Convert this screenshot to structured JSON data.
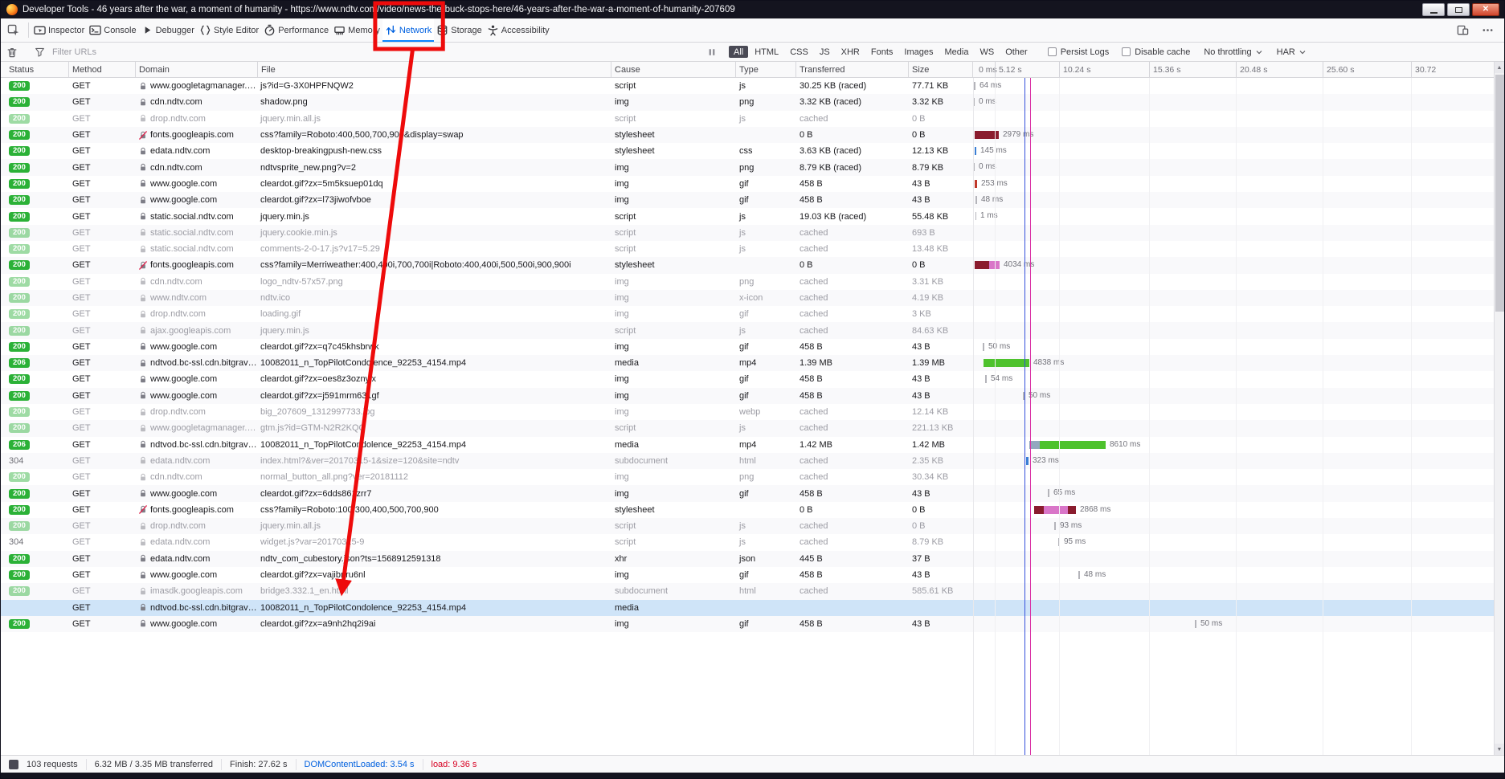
{
  "window": {
    "title": "Developer Tools - 46 years after the war, a moment of humanity - https://www.ndtv.com/video/news-the-buck-stops-here/46-years-after-the-war-a-moment-of-humanity-207609"
  },
  "tabs": [
    {
      "id": "inspector",
      "label": "Inspector",
      "icon": "inspector-icon"
    },
    {
      "id": "console",
      "label": "Console",
      "icon": "console-icon"
    },
    {
      "id": "debugger",
      "label": "Debugger",
      "icon": "debugger-icon"
    },
    {
      "id": "style-editor",
      "label": "Style Editor",
      "icon": "style-editor-icon"
    },
    {
      "id": "performance",
      "label": "Performance",
      "icon": "performance-icon"
    },
    {
      "id": "memory",
      "label": "Memory",
      "icon": "memory-icon"
    },
    {
      "id": "network",
      "label": "Network",
      "icon": "network-icon",
      "active": true
    },
    {
      "id": "storage",
      "label": "Storage",
      "icon": "storage-icon"
    },
    {
      "id": "accessibility",
      "label": "Accessibility",
      "icon": "accessibility-icon"
    }
  ],
  "toolbar_right": [
    {
      "id": "responsive-mode",
      "icon": "responsive-design-mode-icon"
    },
    {
      "id": "meatball-menu",
      "icon": "settings-menu-icon"
    }
  ],
  "filterbar": {
    "placeholder": "Filter URLs",
    "filters": [
      "All",
      "HTML",
      "CSS",
      "JS",
      "XHR",
      "Fonts",
      "Images",
      "Media",
      "WS",
      "Other"
    ],
    "active_filter": "All",
    "persist_logs": "Persist Logs",
    "disable_cache": "Disable cache",
    "throttling": "No throttling",
    "har": "HAR"
  },
  "table": {
    "columns": [
      "Status",
      "Method",
      "Domain",
      "File",
      "Cause",
      "Type",
      "Transferred",
      "Size"
    ],
    "timeline_ticks": [
      "0 ms",
      "5.12 s",
      "10.24 s",
      "15.36 s",
      "20.48 s",
      "25.60 s",
      "30.72"
    ],
    "rows": [
      {
        "status": "200",
        "method": "GET",
        "domain": "www.googletagmanager.com",
        "file": "js?id=G-3X0HPFNQW2",
        "cause": "script",
        "type": "js",
        "transferred": "30.25 KB (raced)",
        "size": "77.71 KB",
        "waterfall": {
          "o": 1,
          "segs": [
            [
              "gray",
              2
            ]
          ],
          "label": "64 ms"
        }
      },
      {
        "status": "200",
        "method": "GET",
        "domain": "cdn.ndtv.com",
        "file": "shadow.png",
        "cause": "img",
        "type": "png",
        "transferred": "3.32 KB (raced)",
        "size": "3.32 KB",
        "waterfall": {
          "o": 1,
          "segs": [
            [
              "gray",
              1
            ]
          ],
          "label": "0 ms"
        }
      },
      {
        "status": "200",
        "method": "GET",
        "domain": "drop.ndtv.com",
        "file": "jquery.min.all.js",
        "cause": "script",
        "type": "js",
        "transferred": "cached",
        "size": "0 B",
        "dim": true
      },
      {
        "status": "200",
        "method": "GET",
        "lock": "broken",
        "domain": "fonts.googleapis.com",
        "file": "css?family=Roboto:400,500,700,900&display=swap",
        "cause": "stylesheet",
        "type": "",
        "transferred": "0 B",
        "size": "0 B",
        "waterfall": {
          "o": 2,
          "segs": [
            [
              "darkred",
              30
            ]
          ],
          "label": "2979 ms"
        }
      },
      {
        "status": "200",
        "method": "GET",
        "domain": "edata.ndtv.com",
        "file": "desktop-breakingpush-new.css",
        "cause": "stylesheet",
        "type": "css",
        "transferred": "3.63 KB (raced)",
        "size": "12.13 KB",
        "waterfall": {
          "o": 2,
          "segs": [
            [
              "blue",
              2
            ]
          ],
          "label": "145 ms"
        }
      },
      {
        "status": "200",
        "method": "GET",
        "domain": "cdn.ndtv.com",
        "file": "ndtvsprite_new.png?v=2",
        "cause": "img",
        "type": "png",
        "transferred": "8.79 KB (raced)",
        "size": "8.79 KB",
        "waterfall": {
          "o": 1,
          "segs": [
            [
              "gray",
              1
            ]
          ],
          "label": "0 ms"
        }
      },
      {
        "status": "200",
        "method": "GET",
        "domain": "www.google.com",
        "file": "cleardot.gif?zx=5m5ksuep01dq",
        "cause": "img",
        "type": "gif",
        "transferred": "458 B",
        "size": "43 B",
        "waterfall": {
          "o": 2,
          "segs": [
            [
              "red",
              3
            ]
          ],
          "label": "253 ms"
        }
      },
      {
        "status": "200",
        "method": "GET",
        "domain": "www.google.com",
        "file": "cleardot.gif?zx=l73jiwofvboe",
        "cause": "img",
        "type": "gif",
        "transferred": "458 B",
        "size": "43 B",
        "waterfall": {
          "o": 3,
          "segs": [
            [
              "gray",
              2
            ]
          ],
          "label": "48 ms"
        }
      },
      {
        "status": "200",
        "method": "GET",
        "domain": "static.social.ndtv.com",
        "file": "jquery.min.js",
        "cause": "script",
        "type": "js",
        "transferred": "19.03 KB (raced)",
        "size": "55.48 KB",
        "waterfall": {
          "o": 3,
          "segs": [
            [
              "gray",
              1
            ]
          ],
          "label": "1 ms"
        }
      },
      {
        "status": "200",
        "method": "GET",
        "domain": "static.social.ndtv.com",
        "file": "jquery.cookie.min.js",
        "cause": "script",
        "type": "js",
        "transferred": "cached",
        "size": "693 B",
        "dim": true
      },
      {
        "status": "200",
        "method": "GET",
        "domain": "static.social.ndtv.com",
        "file": "comments-2-0-17.js?v17=5.29",
        "cause": "script",
        "type": "js",
        "transferred": "cached",
        "size": "13.48 KB",
        "dim": true
      },
      {
        "status": "200",
        "method": "GET",
        "lock": "broken",
        "domain": "fonts.googleapis.com",
        "file": "css?family=Merriweather:400,400i,700,700i|Roboto:400,400i,500,500i,900,900i",
        "cause": "stylesheet",
        "type": "",
        "transferred": "0 B",
        "size": "0 B",
        "waterfall": {
          "o": 2,
          "segs": [
            [
              "darkred",
              18
            ],
            [
              "pink",
              13
            ]
          ],
          "label": "4034 ms"
        }
      },
      {
        "status": "200",
        "method": "GET",
        "domain": "cdn.ndtv.com",
        "file": "logo_ndtv-57x57.png",
        "cause": "img",
        "type": "png",
        "transferred": "cached",
        "size": "3.31 KB",
        "dim": true
      },
      {
        "status": "200",
        "method": "GET",
        "domain": "www.ndtv.com",
        "file": "ndtv.ico",
        "cause": "img",
        "type": "x-icon",
        "transferred": "cached",
        "size": "4.19 KB",
        "dim": true
      },
      {
        "status": "200",
        "method": "GET",
        "domain": "drop.ndtv.com",
        "file": "loading.gif",
        "cause": "img",
        "type": "gif",
        "transferred": "cached",
        "size": "3 KB",
        "dim": true
      },
      {
        "status": "200",
        "method": "GET",
        "domain": "ajax.googleapis.com",
        "file": "jquery.min.js",
        "cause": "script",
        "type": "js",
        "transferred": "cached",
        "size": "84.63 KB",
        "dim": true
      },
      {
        "status": "200",
        "method": "GET",
        "domain": "www.google.com",
        "file": "cleardot.gif?zx=q7c45khsbrwk",
        "cause": "img",
        "type": "gif",
        "transferred": "458 B",
        "size": "43 B",
        "waterfall": {
          "o": 12,
          "segs": [
            [
              "gray",
              2
            ]
          ],
          "label": "50 ms"
        }
      },
      {
        "status": "206",
        "method": "GET",
        "domain": "ndtvod.bc-ssl.cdn.bitgravity.c…",
        "file": "10082011_n_TopPilotCondolence_92253_4154.mp4",
        "cause": "media",
        "type": "mp4",
        "transferred": "1.39 MB",
        "size": "1.39 MB",
        "waterfall": {
          "o": 13,
          "segs": [
            [
              "green",
              57
            ]
          ],
          "label": "4838 ms"
        }
      },
      {
        "status": "200",
        "method": "GET",
        "domain": "www.google.com",
        "file": "cleardot.gif?zx=oes8z3oznyix",
        "cause": "img",
        "type": "gif",
        "transferred": "458 B",
        "size": "43 B",
        "waterfall": {
          "o": 15,
          "segs": [
            [
              "gray",
              2
            ]
          ],
          "label": "54 ms"
        }
      },
      {
        "status": "200",
        "method": "GET",
        "domain": "www.google.com",
        "file": "cleardot.gif?zx=j591mrm631gf",
        "cause": "img",
        "type": "gif",
        "transferred": "458 B",
        "size": "43 B",
        "waterfall": {
          "o": 62,
          "segs": [
            [
              "gray",
              2
            ]
          ],
          "label": "50 ms"
        }
      },
      {
        "status": "200",
        "method": "GET",
        "domain": "drop.ndtv.com",
        "file": "big_207609_1312997733.jpg",
        "cause": "img",
        "type": "webp",
        "transferred": "cached",
        "size": "12.14 KB",
        "dim": true
      },
      {
        "status": "200",
        "method": "GET",
        "domain": "www.googletagmanager.com",
        "file": "gtm.js?id=GTM-N2R2KQQ",
        "cause": "script",
        "type": "js",
        "transferred": "cached",
        "size": "221.13 KB",
        "dim": true
      },
      {
        "status": "206",
        "method": "GET",
        "domain": "ndtvod.bc-ssl.cdn.bitgravity.c…",
        "file": "10082011_n_TopPilotCondolence_92253_4154.mp4",
        "cause": "media",
        "type": "mp4",
        "transferred": "1.42 MB",
        "size": "1.42 MB",
        "waterfall": {
          "o": 70,
          "segs": [
            [
              "slate",
              13
            ],
            [
              "green",
              82
            ]
          ],
          "label": "8610 ms"
        }
      },
      {
        "status": "304",
        "method": "GET",
        "domain": "edata.ndtv.com",
        "file": "index.html?&ver=20170315-1&size=120&site=ndtv",
        "cause": "subdocument",
        "type": "html",
        "transferred": "cached",
        "size": "2.35 KB",
        "dim": true,
        "waterfall": {
          "o": 66,
          "segs": [
            [
              "blue",
              3
            ]
          ],
          "label": "323 ms"
        }
      },
      {
        "status": "200",
        "method": "GET",
        "domain": "cdn.ndtv.com",
        "file": "normal_button_all.png?ver=20181112",
        "cause": "img",
        "type": "png",
        "transferred": "cached",
        "size": "30.34 KB",
        "dim": true
      },
      {
        "status": "200",
        "method": "GET",
        "domain": "www.google.com",
        "file": "cleardot.gif?zx=6dds861zrr7",
        "cause": "img",
        "type": "gif",
        "transferred": "458 B",
        "size": "43 B",
        "waterfall": {
          "o": 93,
          "segs": [
            [
              "gray",
              2
            ]
          ],
          "label": "65 ms"
        }
      },
      {
        "status": "200",
        "method": "GET",
        "lock": "broken",
        "domain": "fonts.googleapis.com",
        "file": "css?family=Roboto:100,300,400,500,700,900",
        "cause": "stylesheet",
        "type": "",
        "transferred": "0 B",
        "size": "0 B",
        "waterfall": {
          "o": 76,
          "segs": [
            [
              "darkred",
              12
            ],
            [
              "pink",
              30
            ],
            [
              "darkred",
              10
            ]
          ],
          "label": "2868 ms"
        }
      },
      {
        "status": "200",
        "method": "GET",
        "domain": "drop.ndtv.com",
        "file": "jquery.min.all.js",
        "cause": "script",
        "type": "js",
        "transferred": "cached",
        "size": "0 B",
        "dim": true,
        "waterfall": {
          "o": 101,
          "segs": [
            [
              "gray",
              2
            ]
          ],
          "label": "93 ms"
        }
      },
      {
        "status": "304",
        "method": "GET",
        "domain": "edata.ndtv.com",
        "file": "widget.js?var=20170315-9",
        "cause": "script",
        "type": "js",
        "transferred": "cached",
        "size": "8.79 KB",
        "dim": true,
        "waterfall": {
          "o": 106,
          "segs": [
            [
              "gray",
              2
            ]
          ],
          "label": "95 ms"
        }
      },
      {
        "status": "200",
        "method": "GET",
        "domain": "edata.ndtv.com",
        "file": "ndtv_com_cubestory.json?ts=1568912591318",
        "cause": "xhr",
        "type": "json",
        "transferred": "445 B",
        "size": "37 B"
      },
      {
        "status": "200",
        "method": "GET",
        "domain": "www.google.com",
        "file": "cleardot.gif?zx=vajibnru6nl",
        "cause": "img",
        "type": "gif",
        "transferred": "458 B",
        "size": "43 B",
        "waterfall": {
          "o": 131,
          "segs": [
            [
              "gray",
              2
            ]
          ],
          "label": "48 ms"
        }
      },
      {
        "status": "200",
        "method": "GET",
        "domain": "imasdk.googleapis.com",
        "file": "bridge3.332.1_en.html",
        "cause": "subdocument",
        "type": "html",
        "transferred": "cached",
        "size": "585.61 KB",
        "dim": true
      },
      {
        "status": "",
        "method": "GET",
        "domain": "ndtvod.bc-ssl.cdn.bitgravity.c…",
        "file": "10082011_n_TopPilotCondolence_92253_4154.mp4",
        "cause": "media",
        "type": "",
        "transferred": "",
        "size": "",
        "selected": true
      },
      {
        "status": "200",
        "method": "GET",
        "domain": "www.google.com",
        "file": "cleardot.gif?zx=a9nh2hq2i9ai",
        "cause": "img",
        "type": "gif",
        "transferred": "458 B",
        "size": "43 B",
        "waterfall": {
          "o": 276,
          "segs": [
            [
              "gray",
              2
            ]
          ],
          "label": "50 ms"
        }
      }
    ]
  },
  "statusbar": {
    "requests": "103 requests",
    "transferred": "6.32 MB / 3.35 MB transferred",
    "finish": "Finish: 27.62 s",
    "domcontentloaded": "DOMContentLoaded: 3.54 s",
    "load": "load: 9.36 s"
  },
  "colors": {
    "status_green": "#2bb137",
    "selected_row": "#cfe4f8",
    "annotation_red": "#ee0b0b",
    "dcl_marker": "#3550dc",
    "load_marker": "#d92fa4",
    "active_tab": "#0061e0"
  }
}
